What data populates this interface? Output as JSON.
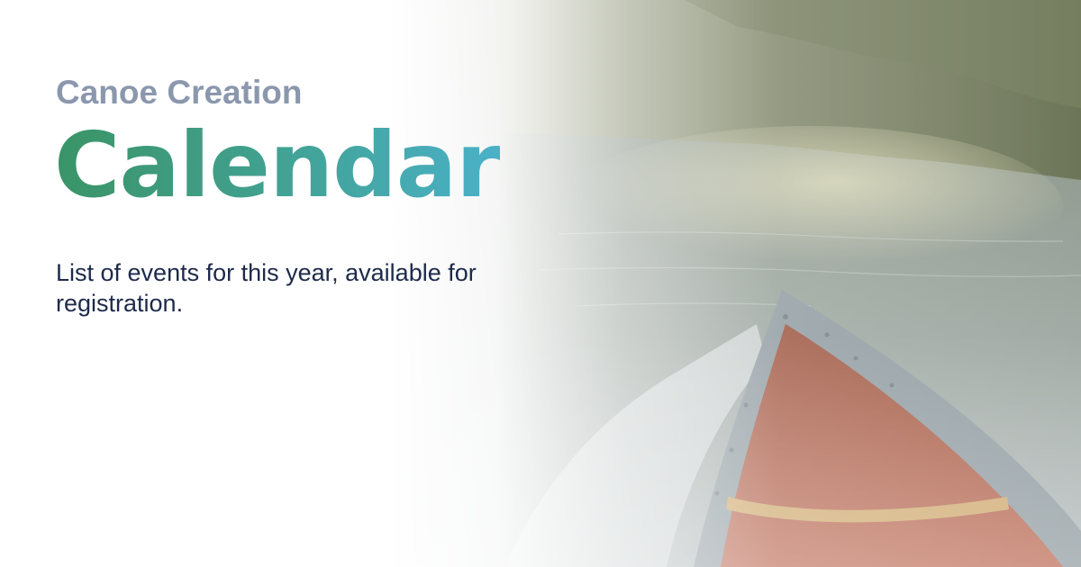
{
  "header": {
    "eyebrow": "Canoe Creation",
    "title": "Calendar",
    "subtitle": "List of events for this year, available for registration."
  },
  "colors": {
    "eyebrow": "#8b97ad",
    "title_gradient_start": "#3a9467",
    "title_gradient_end": "#4ab1c8",
    "subtitle": "#1d2a4a",
    "canoe_hull": "#9a3e25",
    "canoe_rim": "#7f8c92",
    "water": "#6f7c74",
    "trees": "#57613f"
  },
  "background": {
    "scene": "canoe-on-river-photo"
  }
}
